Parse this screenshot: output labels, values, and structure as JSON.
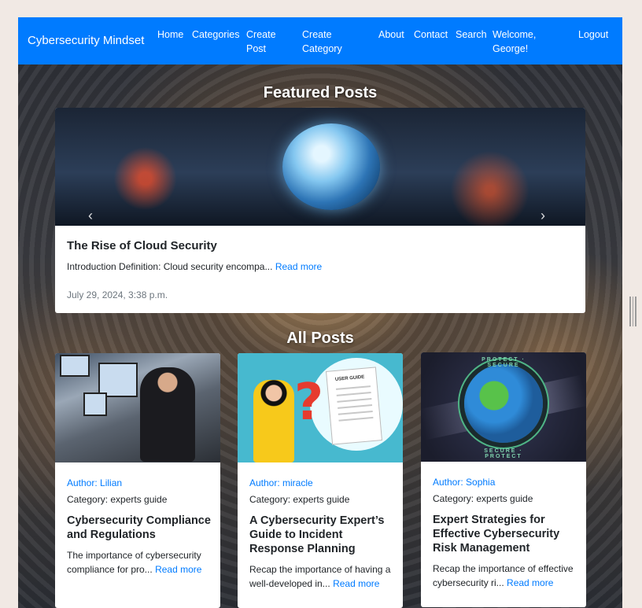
{
  "navbar": {
    "brand": "Cybersecurity Mindset",
    "links": [
      "Home",
      "Categories",
      "Create Post",
      "Create Category",
      "About",
      "Contact",
      "Search",
      "Welcome, George!",
      "Logout"
    ]
  },
  "featured": {
    "heading": "Featured Posts",
    "post": {
      "title": "The Rise of Cloud Security",
      "excerpt": "Introduction Definition: Cloud security encompa...",
      "read_more": "Read more",
      "date": "July 29, 2024, 3:38 p.m."
    },
    "prev_icon": "chevron-left-icon",
    "next_icon": "chevron-right-icon"
  },
  "all_posts": {
    "heading": "All Posts",
    "posts": [
      {
        "author": "Author: Lilian",
        "category": "Category: experts guide",
        "title": "Cybersecurity Compliance and Regulations",
        "excerpt": "The importance of cybersecurity compliance for pro...",
        "read_more": "Read more"
      },
      {
        "author": "Author: miracle",
        "category": "Category: experts guide",
        "title": "A Cybersecurity Expert’s Guide to Incident Response Planning",
        "excerpt": "Recap the importance of having a well-developed in...",
        "read_more": "Read more",
        "image_text": "USER GUIDE"
      },
      {
        "author": "Author: Sophia",
        "category": "Category: experts guide",
        "title": "Expert Strategies for Effective Cybersecurity Risk Management",
        "excerpt": "Recap the importance of effective cybersecurity ri...",
        "read_more": "Read more",
        "image_text_top": "PROTECT · SECURE",
        "image_text_bottom": "SECURE · PROTECT"
      }
    ]
  },
  "colors": {
    "primary": "#007bff",
    "text": "#212529",
    "muted": "#6c757d"
  }
}
